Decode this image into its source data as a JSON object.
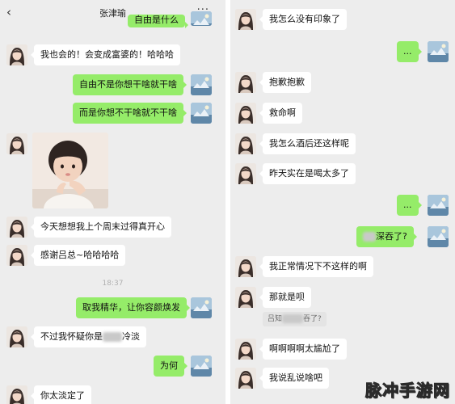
{
  "left_chat": {
    "title": "张津瑜",
    "back_icon": "‹",
    "more_icon": "···",
    "top_partial": "自由是什么",
    "messages": {
      "m1": "我也会的！会变成富婆的！哈哈哈",
      "m2": "自由不是你想干啥就干啥",
      "m3": "而是你想不干啥就不干啥",
      "m4": "今天想想我上个周末过得真开心",
      "m5": "感谢吕总~哈哈哈哈",
      "m6": "取我精华，让你容颜焕发",
      "m7_prefix": "不过我怀疑你是",
      "m7_suffix": "冷淡",
      "m8": "为何",
      "m9": "你太淡定了"
    },
    "timestamp": "18:37"
  },
  "right_chat": {
    "messages": {
      "r1": "我怎么没有印象了",
      "r2": "...",
      "r3": "抱歉抱歉",
      "r4": "救命啊",
      "r5": "我怎么酒后还这样呢",
      "r6": "昨天实在是喝太多了",
      "r7": "...",
      "r8_suffix": "深吞了?",
      "r9": "我正常情况下不这样的啊",
      "r10": "那就是呗",
      "r10_quote_prefix": "吕知",
      "r10_quote_suffix": "吞了?",
      "r11": "啊啊啊啊太尴尬了",
      "r12": "我说乱说啥吧"
    }
  },
  "watermark": "脉冲手游网",
  "colors": {
    "chat_background": "#ededed",
    "bubble_incoming": "#ffffff",
    "bubble_outgoing": "#95ec69"
  }
}
